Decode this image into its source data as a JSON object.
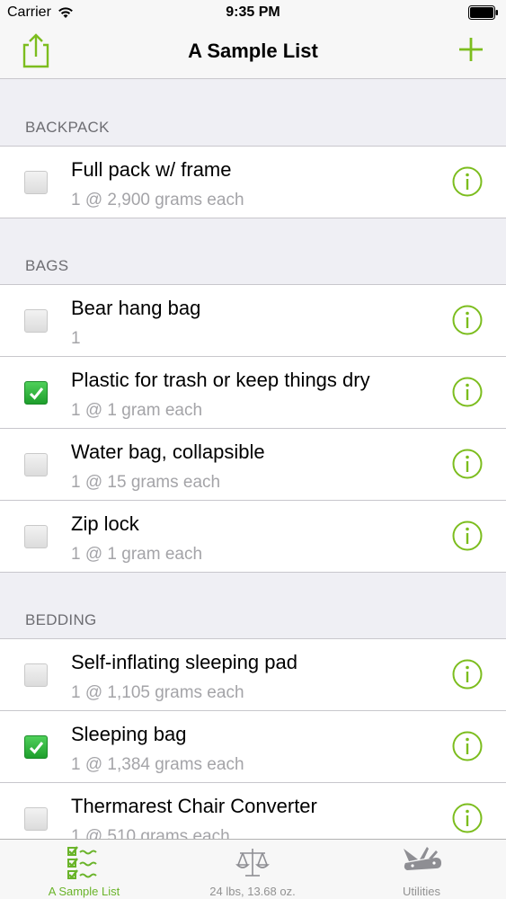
{
  "status_bar": {
    "carrier": "Carrier",
    "time": "9:35 PM"
  },
  "nav": {
    "title": "A Sample List",
    "left_icon": "share-icon",
    "right_icon": "plus-icon"
  },
  "colors": {
    "accent": "#7cbd1e",
    "checked": "#2eb83a"
  },
  "sections": [
    {
      "header": "BACKPACK",
      "items": [
        {
          "name": "Full pack w/ frame",
          "detail": "1 @ 2,900 grams each",
          "checked": false
        }
      ]
    },
    {
      "header": "BAGS",
      "items": [
        {
          "name": "Bear hang bag",
          "detail": "1",
          "checked": false
        },
        {
          "name": "Plastic for trash or keep things dry",
          "detail": "1 @ 1 gram each",
          "checked": true
        },
        {
          "name": "Water bag, collapsible",
          "detail": "1 @ 15 grams each",
          "checked": false
        },
        {
          "name": "Zip lock",
          "detail": "1 @ 1 gram each",
          "checked": false
        }
      ]
    },
    {
      "header": "BEDDING",
      "items": [
        {
          "name": "Self-inflating sleeping pad",
          "detail": "1 @ 1,105 grams each",
          "checked": false
        },
        {
          "name": "Sleeping bag",
          "detail": "1 @ 1,384 grams each",
          "checked": true
        },
        {
          "name": "Thermarest Chair Converter",
          "detail": "1 @ 510 grams each",
          "checked": false
        }
      ]
    }
  ],
  "tabs": [
    {
      "label": "A Sample List",
      "icon": "checklist-icon",
      "active": true
    },
    {
      "label": "24 lbs,  13.68 oz.",
      "icon": "scale-icon",
      "active": false
    },
    {
      "label": "Utilities",
      "icon": "pocket-knife-icon",
      "active": false
    }
  ]
}
